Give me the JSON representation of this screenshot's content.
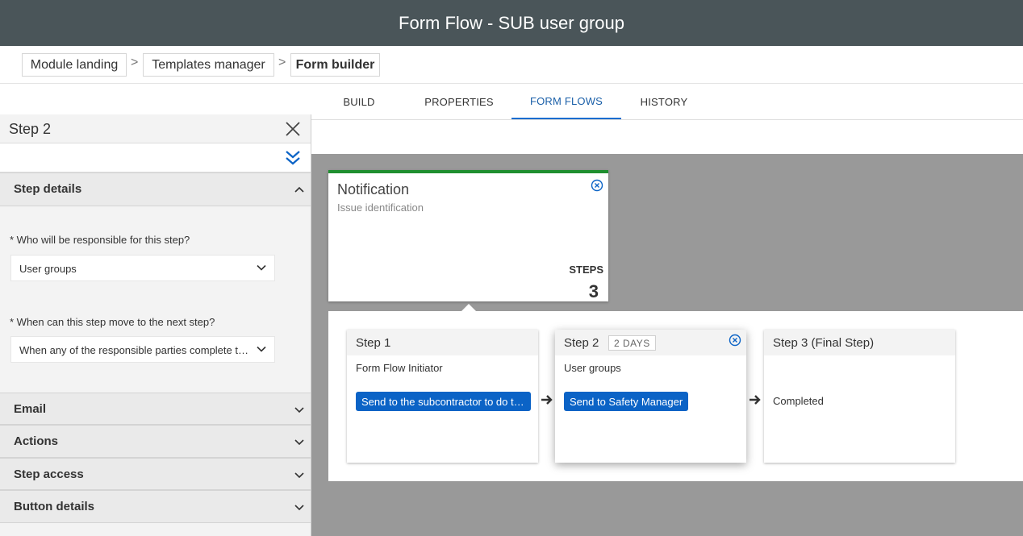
{
  "header": {
    "title": "Form Flow - SUB user group"
  },
  "breadcrumb": {
    "items": [
      "Module landing",
      "Templates manager",
      "Form builder"
    ],
    "separator": ">"
  },
  "tabs": [
    {
      "label": "BUILD",
      "active": false
    },
    {
      "label": "PROPERTIES",
      "active": false
    },
    {
      "label": "FORM FLOWS",
      "active": true
    },
    {
      "label": "HISTORY",
      "active": false
    }
  ],
  "panel": {
    "title": "Step 2",
    "sections": {
      "step_details": "Step details",
      "email": "Email",
      "actions": "Actions",
      "step_access": "Step access",
      "button_details": "Button details"
    },
    "questions": {
      "responsible_label": "* Who will be responsible for this step?",
      "responsible_value": "User groups",
      "move_label": "* When can this step move to the next step?",
      "move_value": "When any of the responsible parties complete the step"
    }
  },
  "notification": {
    "title": "Notification",
    "subtitle": "Issue identification",
    "steps_label": "STEPS",
    "steps_count": "3"
  },
  "steps": [
    {
      "name": "Step 1",
      "responsible": "Form Flow Initiator",
      "button": "Send to the subcontractor to do the work"
    },
    {
      "name": "Step 2",
      "days": "2 DAYS",
      "responsible": "User groups",
      "button": "Send to Safety Manager"
    },
    {
      "name": "Step 3 (Final Step)",
      "status": "Completed"
    }
  ],
  "colors": {
    "header_bg": "#4a5559",
    "accent": "#0b63c6",
    "notification_border": "#1f8f2f",
    "canvas_bg": "#999999"
  }
}
